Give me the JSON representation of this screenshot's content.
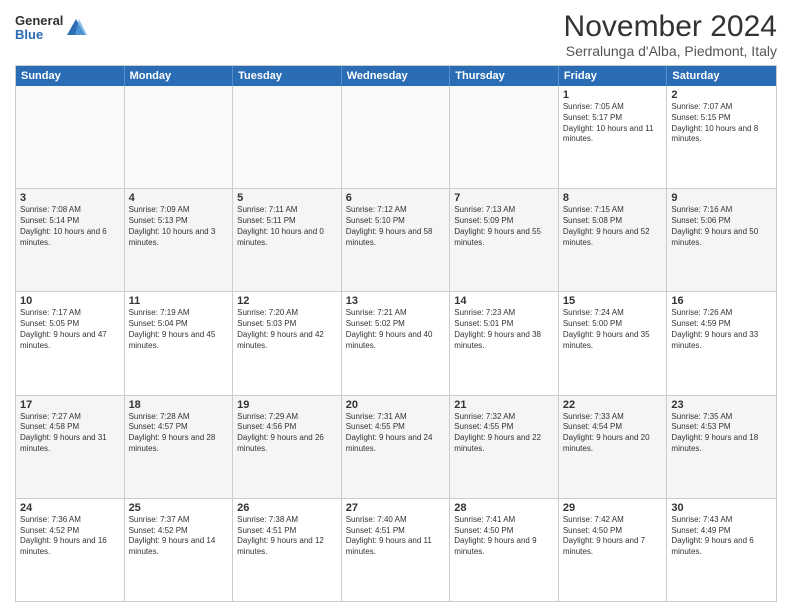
{
  "logo": {
    "general": "General",
    "blue": "Blue"
  },
  "header": {
    "month": "November 2024",
    "location": "Serralunga d'Alba, Piedmont, Italy"
  },
  "weekdays": [
    "Sunday",
    "Monday",
    "Tuesday",
    "Wednesday",
    "Thursday",
    "Friday",
    "Saturday"
  ],
  "rows": [
    [
      {
        "day": "",
        "empty": true
      },
      {
        "day": "",
        "empty": true
      },
      {
        "day": "",
        "empty": true
      },
      {
        "day": "",
        "empty": true
      },
      {
        "day": "",
        "empty": true
      },
      {
        "day": "1",
        "text": "Sunrise: 7:05 AM\nSunset: 5:17 PM\nDaylight: 10 hours and 11 minutes."
      },
      {
        "day": "2",
        "text": "Sunrise: 7:07 AM\nSunset: 5:15 PM\nDaylight: 10 hours and 8 minutes."
      }
    ],
    [
      {
        "day": "3",
        "text": "Sunrise: 7:08 AM\nSunset: 5:14 PM\nDaylight: 10 hours and 6 minutes."
      },
      {
        "day": "4",
        "text": "Sunrise: 7:09 AM\nSunset: 5:13 PM\nDaylight: 10 hours and 3 minutes."
      },
      {
        "day": "5",
        "text": "Sunrise: 7:11 AM\nSunset: 5:11 PM\nDaylight: 10 hours and 0 minutes."
      },
      {
        "day": "6",
        "text": "Sunrise: 7:12 AM\nSunset: 5:10 PM\nDaylight: 9 hours and 58 minutes."
      },
      {
        "day": "7",
        "text": "Sunrise: 7:13 AM\nSunset: 5:09 PM\nDaylight: 9 hours and 55 minutes."
      },
      {
        "day": "8",
        "text": "Sunrise: 7:15 AM\nSunset: 5:08 PM\nDaylight: 9 hours and 52 minutes."
      },
      {
        "day": "9",
        "text": "Sunrise: 7:16 AM\nSunset: 5:06 PM\nDaylight: 9 hours and 50 minutes."
      }
    ],
    [
      {
        "day": "10",
        "text": "Sunrise: 7:17 AM\nSunset: 5:05 PM\nDaylight: 9 hours and 47 minutes."
      },
      {
        "day": "11",
        "text": "Sunrise: 7:19 AM\nSunset: 5:04 PM\nDaylight: 9 hours and 45 minutes."
      },
      {
        "day": "12",
        "text": "Sunrise: 7:20 AM\nSunset: 5:03 PM\nDaylight: 9 hours and 42 minutes."
      },
      {
        "day": "13",
        "text": "Sunrise: 7:21 AM\nSunset: 5:02 PM\nDaylight: 9 hours and 40 minutes."
      },
      {
        "day": "14",
        "text": "Sunrise: 7:23 AM\nSunset: 5:01 PM\nDaylight: 9 hours and 38 minutes."
      },
      {
        "day": "15",
        "text": "Sunrise: 7:24 AM\nSunset: 5:00 PM\nDaylight: 9 hours and 35 minutes."
      },
      {
        "day": "16",
        "text": "Sunrise: 7:26 AM\nSunset: 4:59 PM\nDaylight: 9 hours and 33 minutes."
      }
    ],
    [
      {
        "day": "17",
        "text": "Sunrise: 7:27 AM\nSunset: 4:58 PM\nDaylight: 9 hours and 31 minutes."
      },
      {
        "day": "18",
        "text": "Sunrise: 7:28 AM\nSunset: 4:57 PM\nDaylight: 9 hours and 28 minutes."
      },
      {
        "day": "19",
        "text": "Sunrise: 7:29 AM\nSunset: 4:56 PM\nDaylight: 9 hours and 26 minutes."
      },
      {
        "day": "20",
        "text": "Sunrise: 7:31 AM\nSunset: 4:55 PM\nDaylight: 9 hours and 24 minutes."
      },
      {
        "day": "21",
        "text": "Sunrise: 7:32 AM\nSunset: 4:55 PM\nDaylight: 9 hours and 22 minutes."
      },
      {
        "day": "22",
        "text": "Sunrise: 7:33 AM\nSunset: 4:54 PM\nDaylight: 9 hours and 20 minutes."
      },
      {
        "day": "23",
        "text": "Sunrise: 7:35 AM\nSunset: 4:53 PM\nDaylight: 9 hours and 18 minutes."
      }
    ],
    [
      {
        "day": "24",
        "text": "Sunrise: 7:36 AM\nSunset: 4:52 PM\nDaylight: 9 hours and 16 minutes."
      },
      {
        "day": "25",
        "text": "Sunrise: 7:37 AM\nSunset: 4:52 PM\nDaylight: 9 hours and 14 minutes."
      },
      {
        "day": "26",
        "text": "Sunrise: 7:38 AM\nSunset: 4:51 PM\nDaylight: 9 hours and 12 minutes."
      },
      {
        "day": "27",
        "text": "Sunrise: 7:40 AM\nSunset: 4:51 PM\nDaylight: 9 hours and 11 minutes."
      },
      {
        "day": "28",
        "text": "Sunrise: 7:41 AM\nSunset: 4:50 PM\nDaylight: 9 hours and 9 minutes."
      },
      {
        "day": "29",
        "text": "Sunrise: 7:42 AM\nSunset: 4:50 PM\nDaylight: 9 hours and 7 minutes."
      },
      {
        "day": "30",
        "text": "Sunrise: 7:43 AM\nSunset: 4:49 PM\nDaylight: 9 hours and 6 minutes."
      }
    ]
  ]
}
